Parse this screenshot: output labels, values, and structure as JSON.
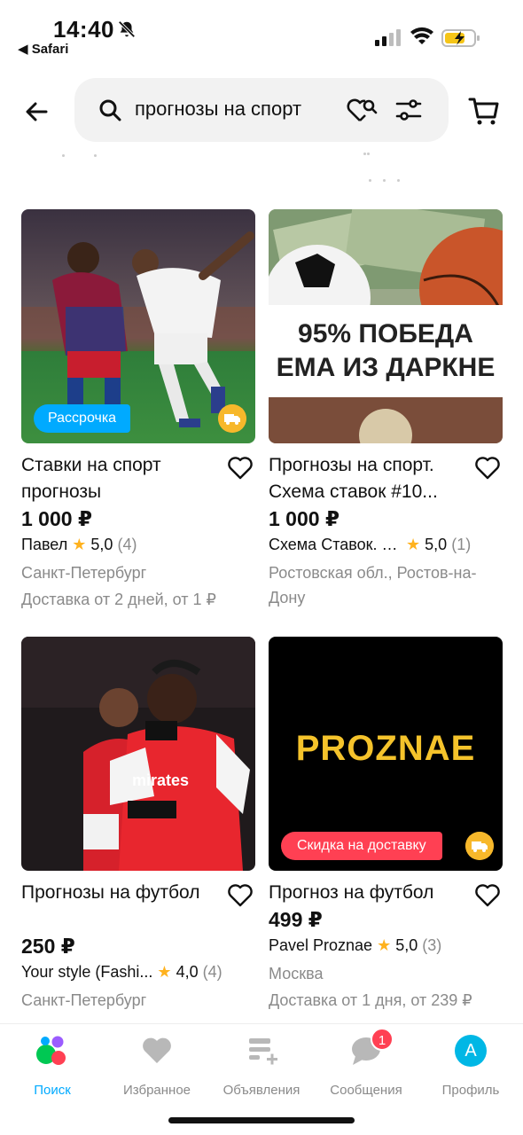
{
  "status_bar": {
    "time": "14:40",
    "back_app": "◀ Safari"
  },
  "search": {
    "query": "прогнозы на спорт"
  },
  "colors": {
    "accent": "#00aaff",
    "badge_red": "#ff4053",
    "rating_star": "#ffb21e",
    "muted_text": "#8a8a8a"
  },
  "products": [
    {
      "title": "Ставки на спорт прогнозы",
      "price": "1 000 ₽",
      "seller": "Павел",
      "rating": "5,0",
      "reviews": "(4)",
      "city": "Санкт-Петербург",
      "delivery": "Доставка от 2 дней, от 1 ₽",
      "badge": "Рассрочка",
      "image": "football-players-photo"
    },
    {
      "title": "Прогнозы на спорт. Схема ставок #10...",
      "price": "1 000 ₽",
      "seller": "Схема Ставок. Д...",
      "rating": "5,0",
      "reviews": "(1)",
      "city": "Ростовская обл., Ростов-на-Дону",
      "image_text_1": "95% ПОБЕДА",
      "image_text_2": "ЕМА ИЗ ДАРКНЕ",
      "image": "money-and-balls-photo"
    },
    {
      "title": "Прогнозы на футбол",
      "price": "250 ₽",
      "seller": "Your style   (Fashi...",
      "rating": "4,0",
      "reviews": "(4)",
      "city": "Санкт-Петербург",
      "image": "arsenal-players-photo"
    },
    {
      "title": "Прогноз на футбол",
      "price": "499 ₽",
      "seller": "Pavel Proznae",
      "rating": "5,0",
      "reviews": "(3)",
      "city": "Москва",
      "delivery": "Доставка от 1 дня, от 239 ₽",
      "badge": "Скидка на доставку",
      "image_text": "PROZNAE",
      "image": "proznae-logo-black"
    }
  ],
  "nav": {
    "search": "Поиск",
    "favorites": "Избранное",
    "ads": "Объявления",
    "messages": "Сообщения",
    "messages_badge": "1",
    "profile": "Профиль",
    "profile_initial": "A"
  }
}
